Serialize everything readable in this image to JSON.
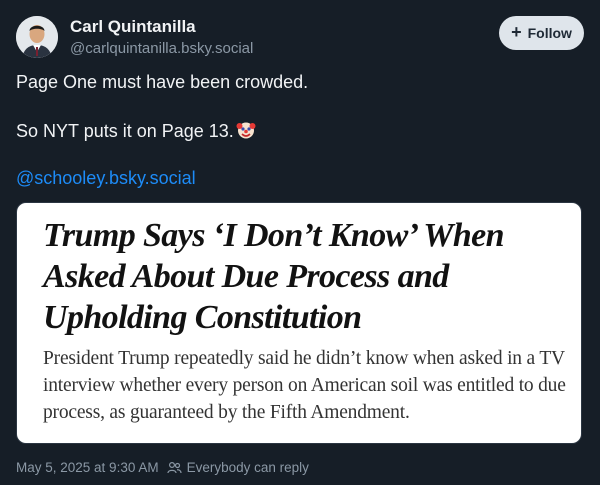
{
  "author": {
    "name": "Carl Quintanilla",
    "handle": "@carlquintanilla.bsky.social"
  },
  "follow_label": "Follow",
  "post": {
    "line1": "Page One must have been crowded.",
    "line2": "So NYT puts it on Page 13.",
    "line2_emoji_icon": "clown-face-icon",
    "mention": "@schooley.bsky.social"
  },
  "embed": {
    "headline": "Trump Says ‘I Don’t Know’ When Asked About Due Process and Upholding Constitution",
    "summary": "President Trump repeatedly said he didn’t know when asked in a TV interview whether every person on American soil was entitled to due process, as guaranteed by the Fifth Amendment."
  },
  "footer": {
    "timestamp": "May 5, 2025 at 9:30 AM",
    "reply_setting": "Everybody can reply",
    "reply_icon": "people-icon"
  },
  "colors": {
    "background": "#161e27",
    "link": "#1d8cf8",
    "muted": "#8b98a5",
    "follow_bg": "#dfe5eb"
  }
}
